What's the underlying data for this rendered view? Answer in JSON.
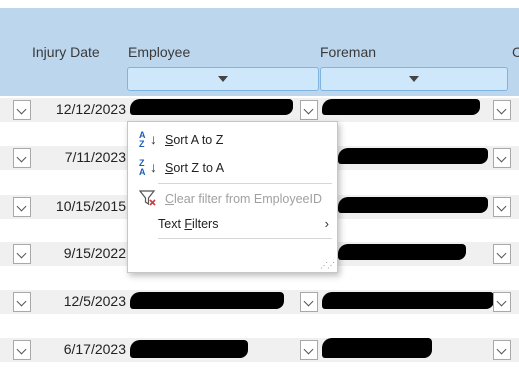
{
  "columns": {
    "injury_date": "Injury Date",
    "employee": "Employee",
    "foreman": "Foreman",
    "partial_next": "C"
  },
  "rows": [
    {
      "date": "12/12/2023"
    },
    {
      "date": "7/11/2023"
    },
    {
      "date": "10/15/2015"
    },
    {
      "date": "9/15/2022"
    },
    {
      "date": "12/5/2023"
    },
    {
      "date": "6/17/2023"
    }
  ],
  "context_menu": {
    "sort_az": {
      "accel": "S",
      "rest": "ort A to Z",
      "icon": "sort-ascending-icon"
    },
    "sort_za": {
      "accel": "S",
      "rest": "ort Z to A",
      "icon": "sort-descending-icon"
    },
    "clear_filter": {
      "accel": "C",
      "rest": "lear filter from EmployeeID",
      "icon": "clear-filter-icon"
    },
    "text_filters": {
      "pre": "Text ",
      "accel": "F",
      "rest": "ilters"
    }
  },
  "icon_letters": {
    "az_top": "A",
    "az_bottom": "Z",
    "za_top": "Z",
    "za_bottom": "A"
  }
}
